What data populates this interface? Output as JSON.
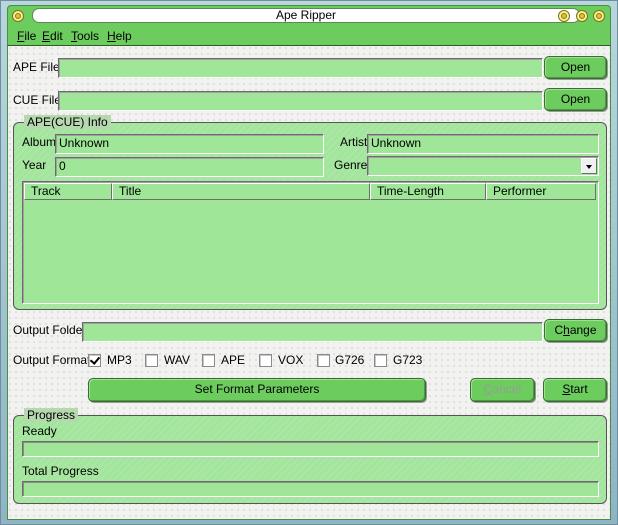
{
  "window": {
    "title": "Ape Ripper"
  },
  "menu": {
    "items": [
      {
        "label": "File",
        "mnemonic": "F",
        "rest": "ile"
      },
      {
        "label": "Edit",
        "mnemonic": "E",
        "rest": "dit"
      },
      {
        "label": "Tools",
        "mnemonic": "T",
        "rest": "ools"
      },
      {
        "label": "Help",
        "mnemonic": "H",
        "rest": "elp"
      }
    ]
  },
  "files": {
    "ape_label": "APE File",
    "ape_value": "",
    "ape_open": "Open",
    "cue_label": "CUE File",
    "cue_value": "",
    "cue_open": "Open"
  },
  "info": {
    "legend": "APE(CUE) Info",
    "album_label": "Album",
    "album_value": "Unknown",
    "artist_label": "Artist",
    "artist_value": "Unknown",
    "year_label": "Year",
    "year_value": "0",
    "genre_label": "Genre",
    "genre_value": "",
    "columns": [
      "Track",
      "Title",
      "Time-Length",
      "Performer"
    ],
    "rows": []
  },
  "output": {
    "folder_label": "Output Folder",
    "folder_value": "",
    "change_label": "Change",
    "change_mnemonic_prefix": "C",
    "change_mnemonic": "h",
    "change_mnemonic_suffix": "ange",
    "format_label": "Output Format:",
    "formats": [
      {
        "label": "MP3",
        "checked": true
      },
      {
        "label": "WAV",
        "checked": false
      },
      {
        "label": "APE",
        "checked": false
      },
      {
        "label": "VOX",
        "checked": false
      },
      {
        "label": "G726",
        "checked": false
      },
      {
        "label": "G723",
        "checked": false
      }
    ]
  },
  "actions": {
    "set_format_label": "Set Format Parameters",
    "cancel_mnemonic": "C",
    "cancel_rest": "ancel",
    "cancel_enabled": false,
    "start_mnemonic": "S",
    "start_rest": "tart"
  },
  "progress": {
    "legend": "Progress",
    "status_label": "Ready",
    "current_percent": 0,
    "total_label": "Total Progress",
    "total_percent": 0
  },
  "colors": {
    "chrome_green": "#6ccc5e",
    "field_green": "#9fe699",
    "group_green": "#a3e59d"
  }
}
